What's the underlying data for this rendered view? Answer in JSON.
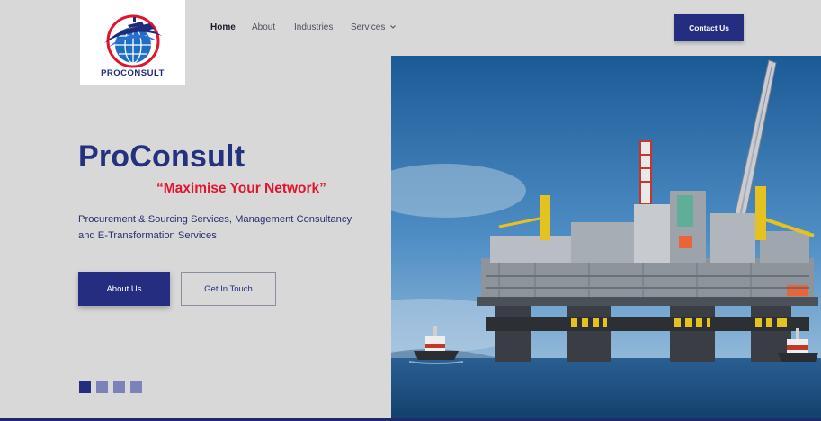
{
  "brand": {
    "name": "PROCONSULT",
    "logo_icon": "ship-globe-logo"
  },
  "nav": {
    "items": [
      {
        "label": "Home",
        "active": true
      },
      {
        "label": "About",
        "active": false
      },
      {
        "label": "Industries",
        "active": false
      },
      {
        "label": "Services",
        "active": false,
        "has_dropdown": true
      }
    ],
    "dropdown_icon": "chevron-down-icon",
    "contact_label": "Contact Us"
  },
  "hero": {
    "title": "ProConsult",
    "tagline": "“Maximise Your Network”",
    "description": "Procurement & Sourcing Services, Management Consultancy and E-Transformation Services",
    "primary_button": "About Us",
    "secondary_button": "Get In Touch",
    "image": "offshore-oil-platform-photo",
    "slide_count": 4,
    "active_slide": 1
  },
  "colors": {
    "primary": "#252d80",
    "accent": "#e2142d",
    "background": "#d8d8d8"
  }
}
